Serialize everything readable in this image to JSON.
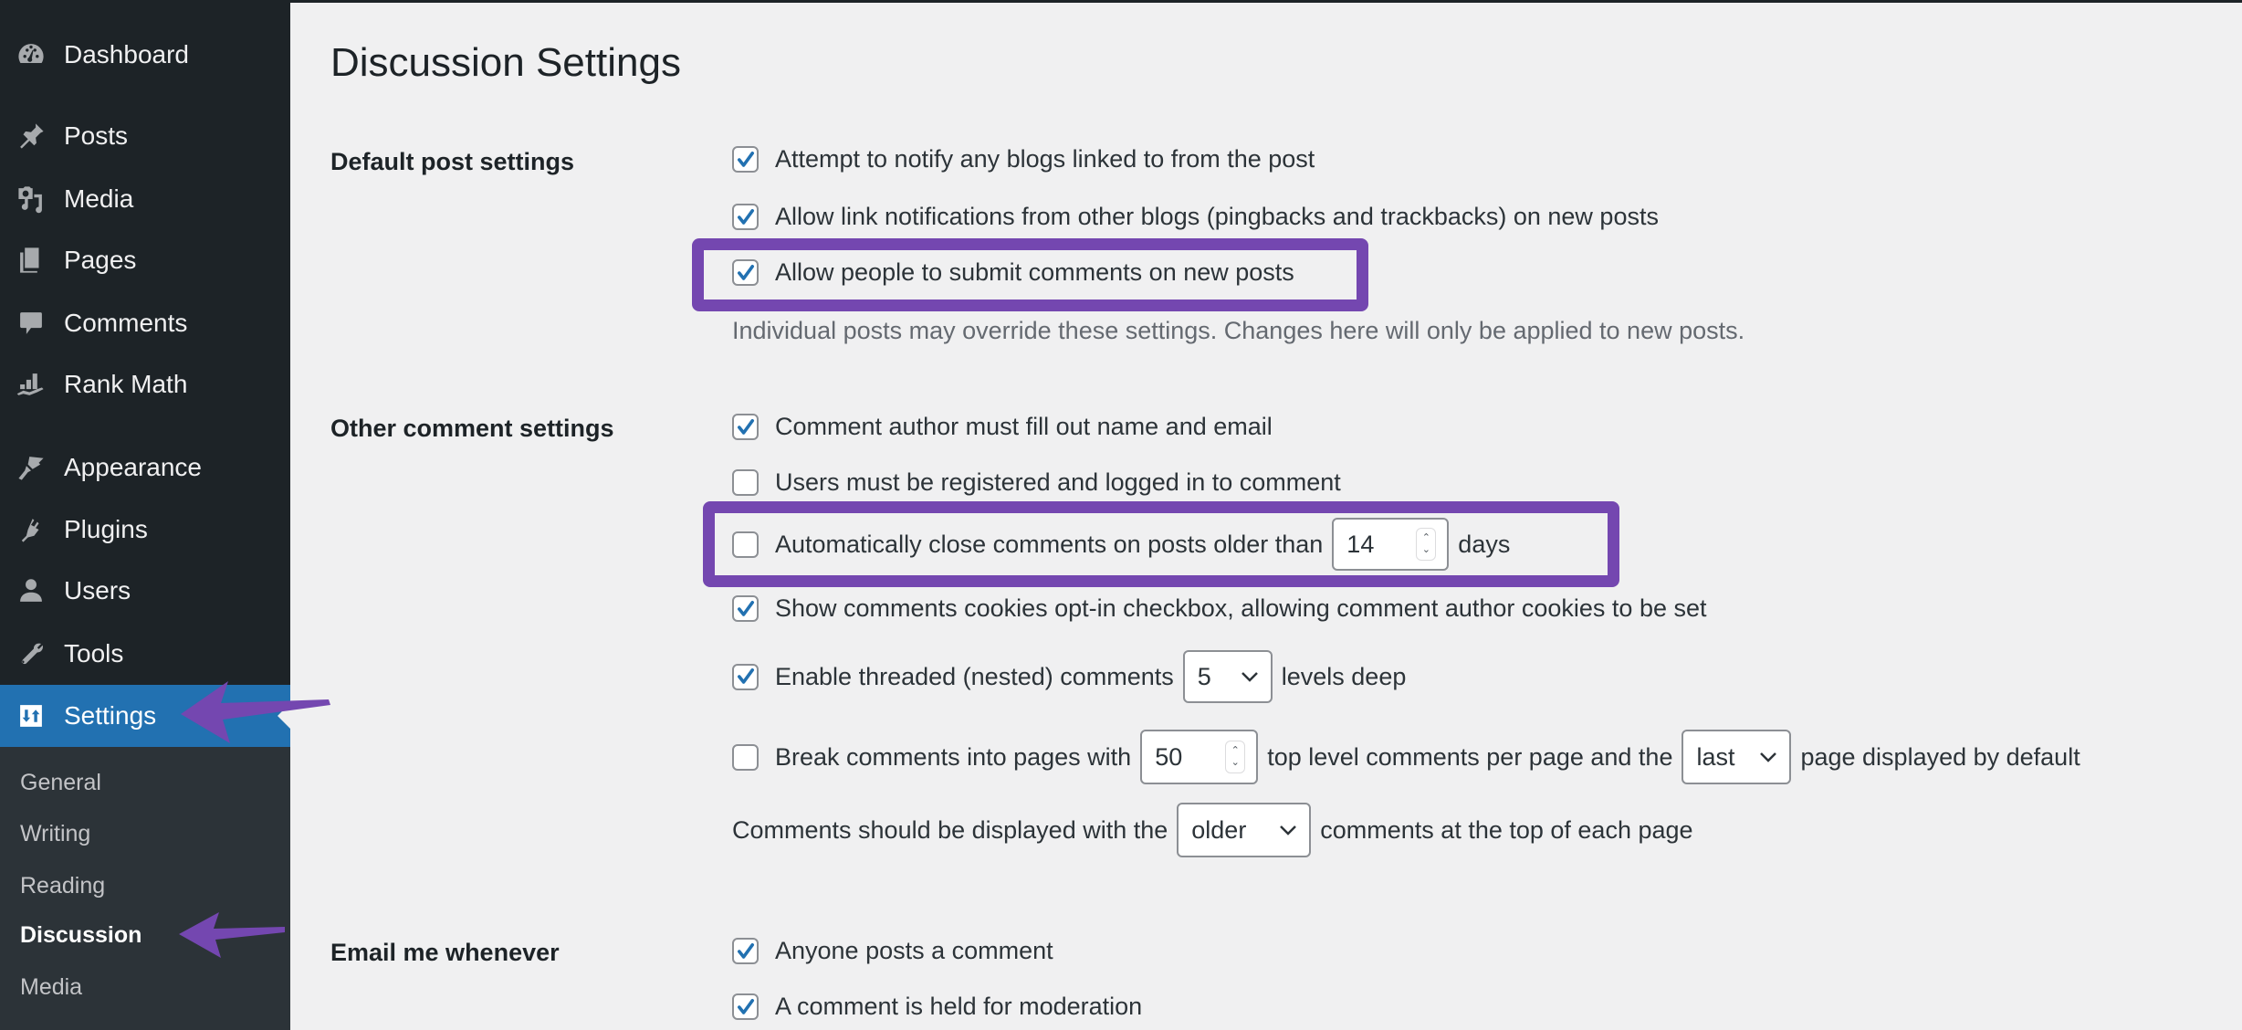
{
  "sidebar": {
    "items": [
      {
        "label": "Dashboard",
        "icon": "dashboard-icon"
      },
      {
        "label": "Posts",
        "icon": "pin-icon"
      },
      {
        "label": "Media",
        "icon": "media-icon"
      },
      {
        "label": "Pages",
        "icon": "pages-icon"
      },
      {
        "label": "Comments",
        "icon": "comment-icon"
      },
      {
        "label": "Rank Math",
        "icon": "rank-math-icon"
      },
      {
        "label": "Appearance",
        "icon": "paintbrush-icon"
      },
      {
        "label": "Plugins",
        "icon": "plugin-icon"
      },
      {
        "label": "Users",
        "icon": "user-icon"
      },
      {
        "label": "Tools",
        "icon": "wrench-icon"
      },
      {
        "label": "Settings",
        "icon": "settings-icon",
        "active": true
      }
    ],
    "submenu": [
      {
        "label": "General"
      },
      {
        "label": "Writing"
      },
      {
        "label": "Reading"
      },
      {
        "label": "Discussion",
        "current": true
      },
      {
        "label": "Media"
      }
    ]
  },
  "page": {
    "title": "Discussion Settings"
  },
  "sections": {
    "default_post": {
      "label": "Default post settings",
      "options": [
        {
          "label": "Attempt to notify any blogs linked to from the post",
          "checked": true
        },
        {
          "label": "Allow link notifications from other blogs (pingbacks and trackbacks) on new posts",
          "checked": true
        },
        {
          "label": "Allow people to submit comments on new posts",
          "checked": true,
          "highlighted": true
        }
      ],
      "description": "Individual posts may override these settings. Changes here will only be applied to new posts."
    },
    "other_comment": {
      "label": "Other comment settings",
      "options": [
        {
          "label": "Comment author must fill out name and email",
          "checked": true
        },
        {
          "label": "Users must be registered and logged in to comment",
          "checked": false
        },
        {
          "label_before": "Automatically close comments on posts older than",
          "value": "14",
          "label_after": "days",
          "checked": false,
          "highlighted": true
        },
        {
          "label": "Show comments cookies opt-in checkbox, allowing comment author cookies to be set",
          "checked": true
        },
        {
          "label_before": "Enable threaded (nested) comments",
          "select_value": "5",
          "label_after": "levels deep",
          "checked": true
        },
        {
          "label_before": "Break comments into pages with",
          "value": "50",
          "label_middle": "top level comments per page and the",
          "select_value": "last",
          "label_after": "page displayed by default",
          "checked": false
        }
      ],
      "display_order": {
        "label_before": "Comments should be displayed with the",
        "select_value": "older",
        "label_after": "comments at the top of each page"
      }
    },
    "email": {
      "label": "Email me whenever",
      "options": [
        {
          "label": "Anyone posts a comment",
          "checked": true
        },
        {
          "label": "A comment is held for moderation",
          "checked": true
        }
      ]
    }
  },
  "colors": {
    "sidebar_bg": "#1d2327",
    "submenu_bg": "#2c3338",
    "active_bg": "#2271b1",
    "highlight": "#7447b0",
    "checkmark": "#2271b1"
  }
}
